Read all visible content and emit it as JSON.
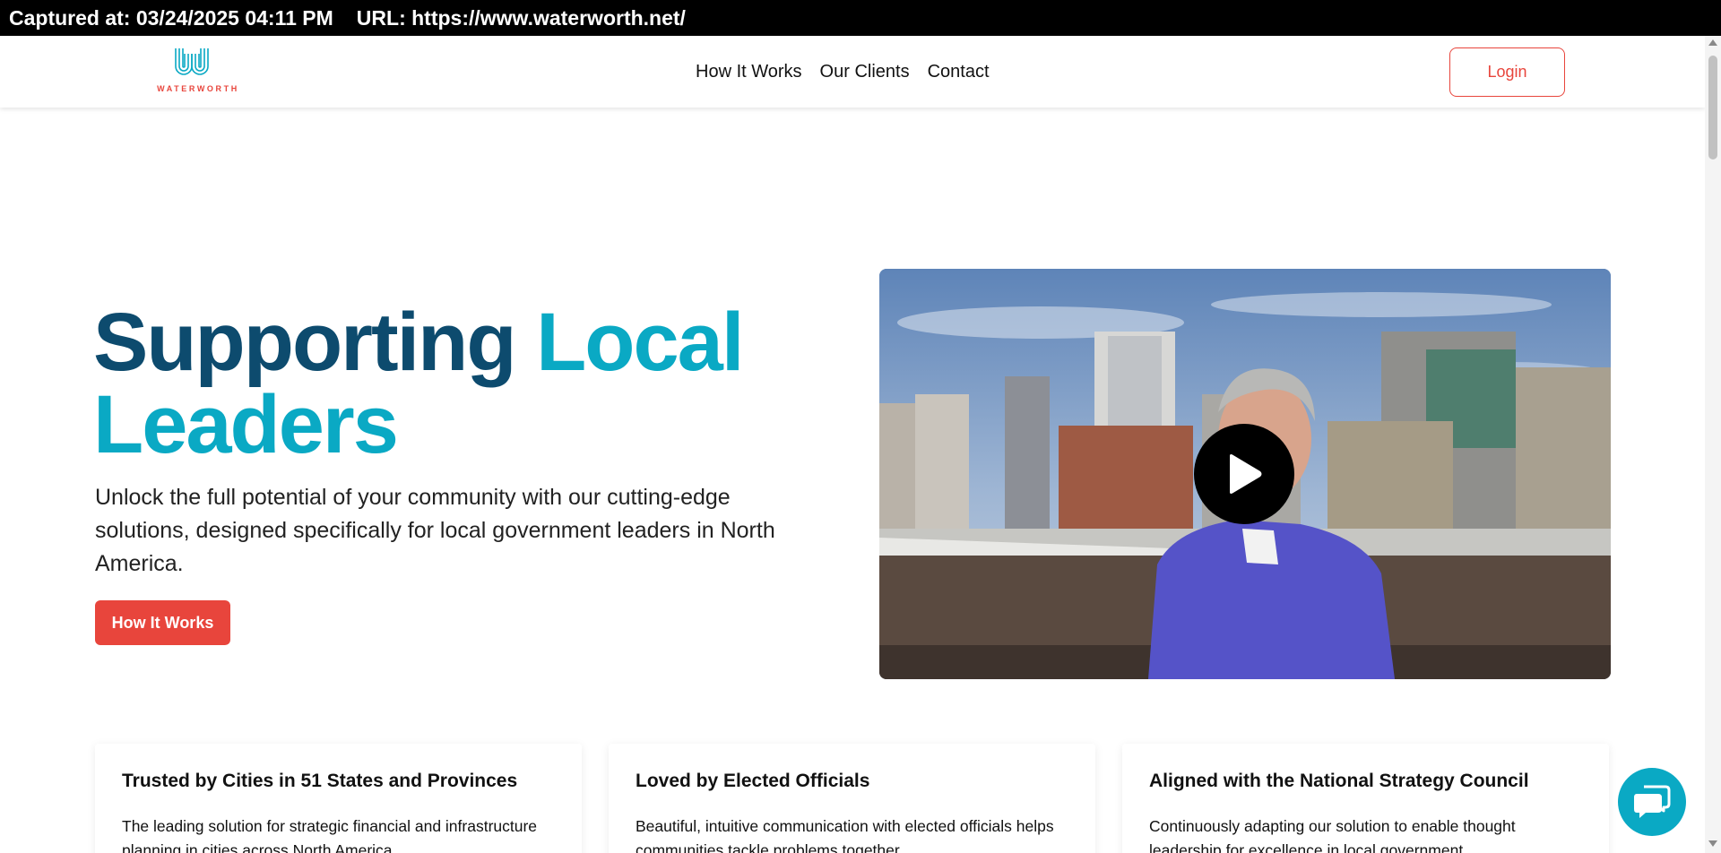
{
  "capture": {
    "captured_at": "Captured at: 03/24/2025 04:11 PM",
    "url": "URL: https://www.waterworth.net/"
  },
  "navbar": {
    "logo_text": "WATERWORTH",
    "links": [
      "How It Works",
      "Our Clients",
      "Contact"
    ],
    "login_label": "Login"
  },
  "hero": {
    "title_part1": "Supporting",
    "title_part2": "Local",
    "title_part3": "Leaders",
    "subtitle": "Unlock the full potential of your community with our cutting-edge solutions, designed specifically for local government leaders in North America.",
    "cta_label": "How It Works"
  },
  "video": {
    "play_icon": "play-icon"
  },
  "cards": [
    {
      "title": "Trusted by Cities in 51 States and Provinces",
      "body": "The leading solution for strategic financial and infrastructure planning in cities across North America."
    },
    {
      "title": "Loved by Elected Officials",
      "body": "Beautiful, intuitive communication with elected officials helps communities tackle problems together."
    },
    {
      "title": "Aligned with the National Strategy Council",
      "body": "Continuously adapting our solution to enable thought leadership for excellence in local government."
    }
  ],
  "chat": {
    "icon": "chat-icon"
  },
  "colors": {
    "accent_red": "#e8453c",
    "brand_dark": "#0d4b6e",
    "brand_teal": "#0aa9c4"
  }
}
